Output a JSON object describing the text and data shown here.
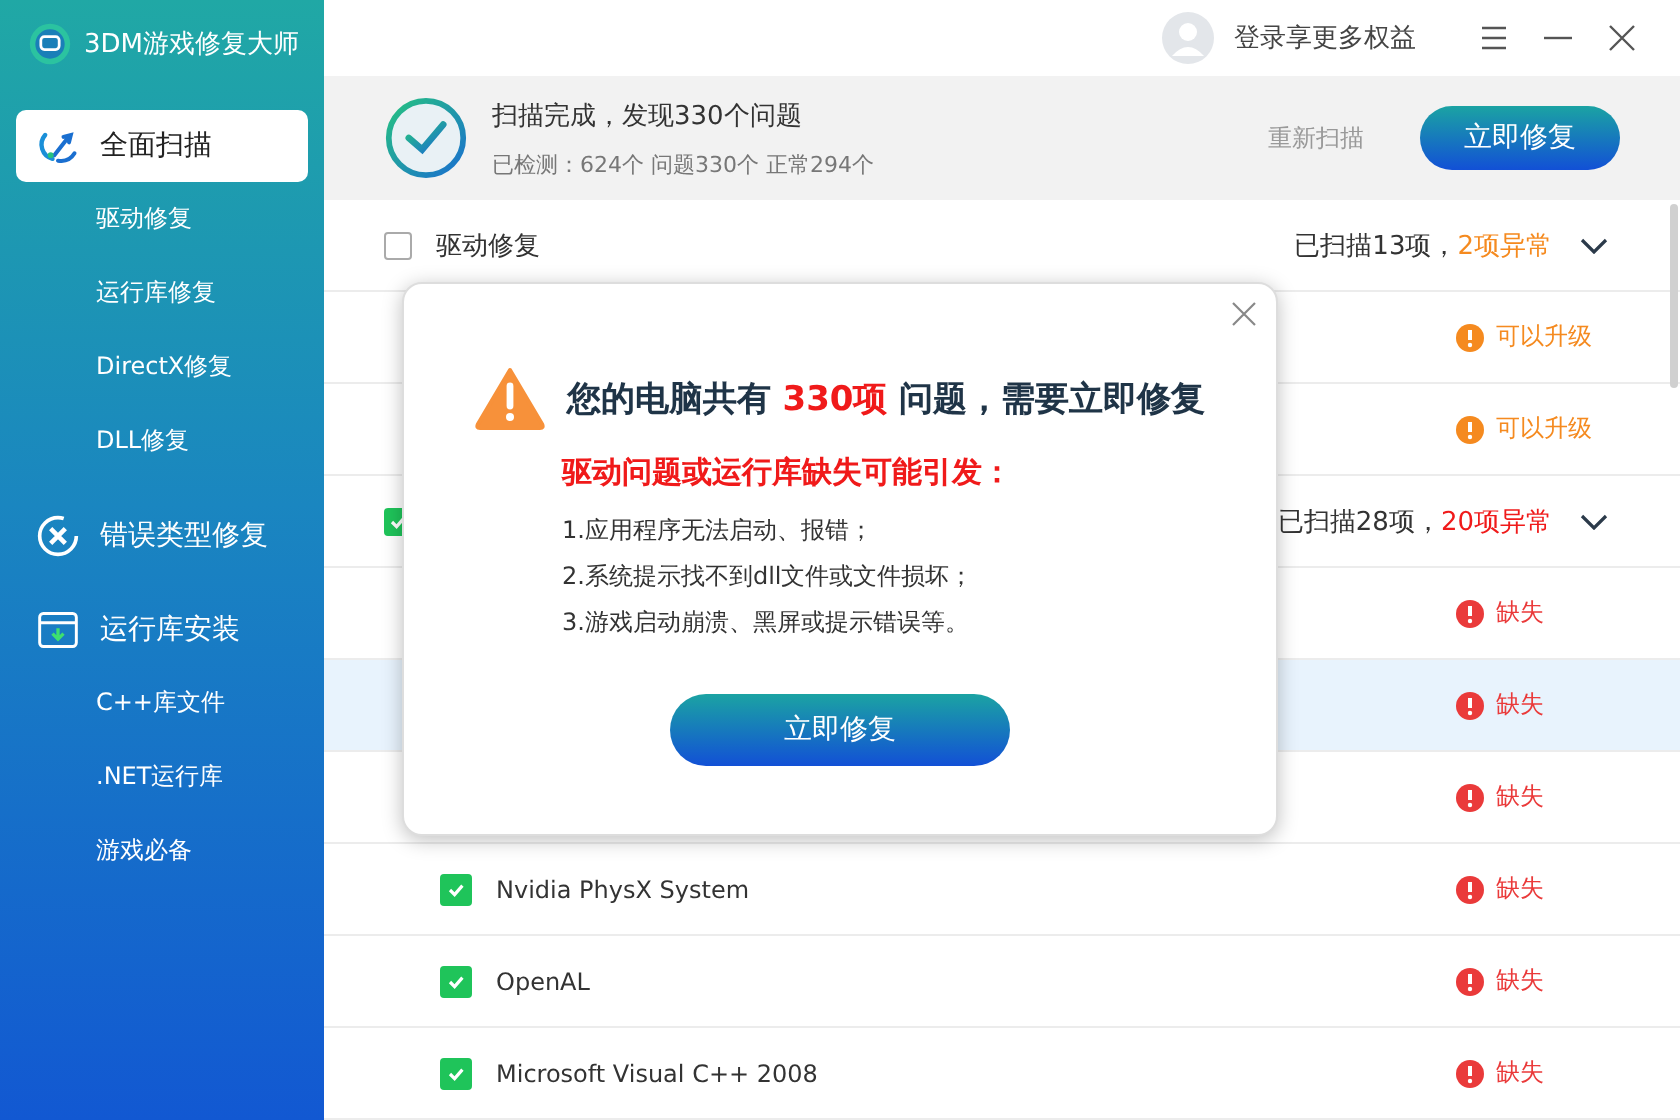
{
  "app": {
    "title": "3DM游戏修复大师"
  },
  "sidebar": {
    "items": [
      {
        "kind": "main",
        "label": "全面扫描",
        "selected": true
      },
      {
        "kind": "sub",
        "label": "驱动修复",
        "selected": false
      },
      {
        "kind": "sub",
        "label": "运行库修复",
        "selected": false
      },
      {
        "kind": "sub",
        "label": "DirectX修复",
        "selected": false
      },
      {
        "kind": "sub",
        "label": "DLL修复",
        "selected": false
      },
      {
        "kind": "main",
        "label": "错误类型修复",
        "selected": false
      },
      {
        "kind": "main",
        "label": "运行库安装",
        "selected": false
      },
      {
        "kind": "sub",
        "label": "C++库文件",
        "selected": false
      },
      {
        "kind": "sub",
        "label": ".NET运行库",
        "selected": false
      },
      {
        "kind": "sub",
        "label": "游戏必备",
        "selected": false
      }
    ]
  },
  "topbar": {
    "login": "登录享更多权益"
  },
  "summary": {
    "title": "扫描完成，发现330个问题",
    "detail": "已检测：624个 问题330个 正常294个",
    "rescan": "重新扫描",
    "fix": "立即修复"
  },
  "list": [
    {
      "kind": "group",
      "label": "驱动修复",
      "checked": false,
      "scanned": "已扫描13项，",
      "issues": "2项异常",
      "color": "#f58a1f",
      "selected": false
    },
    {
      "kind": "item",
      "status_text": "可以升级",
      "color": "#f58a1f",
      "selected": false
    },
    {
      "kind": "item",
      "status_text": "可以升级",
      "color": "#f58a1f",
      "selected": false
    },
    {
      "kind": "group",
      "checked": true,
      "scanned": "已扫描28项，",
      "issues": "20项异常",
      "color": "#f01a1a",
      "selected": false
    },
    {
      "kind": "item",
      "status_text": "缺失",
      "color": "#ea3a3a",
      "selected": false
    },
    {
      "kind": "item",
      "status_text": "缺失",
      "color": "#ea3a3a",
      "selected": true
    },
    {
      "kind": "item",
      "status_text": "缺失",
      "color": "#ea3a3a",
      "selected": false
    },
    {
      "kind": "item",
      "label": "Nvidia PhysX System",
      "checked": true,
      "status_text": "缺失",
      "color": "#ea3a3a",
      "selected": false
    },
    {
      "kind": "item",
      "label": "OpenAL",
      "checked": true,
      "status_text": "缺失",
      "color": "#ea3a3a",
      "selected": false
    },
    {
      "kind": "item",
      "label": "Microsoft Visual C++ 2008",
      "checked": true,
      "status_text": "缺失",
      "color": "#ea3a3a",
      "selected": false
    }
  ],
  "dialog": {
    "headline": "您的电脑共有 **330项** 问题，需要立即修复",
    "subhead": "驱动问题或运行库缺失可能引发：",
    "points": [
      "1.应用程序无法启动、报错；",
      "2.系统提示找不到dll文件或文件损坏；",
      "3.游戏启动崩溃、黑屏或提示错误等。"
    ],
    "button": "立即修复"
  }
}
